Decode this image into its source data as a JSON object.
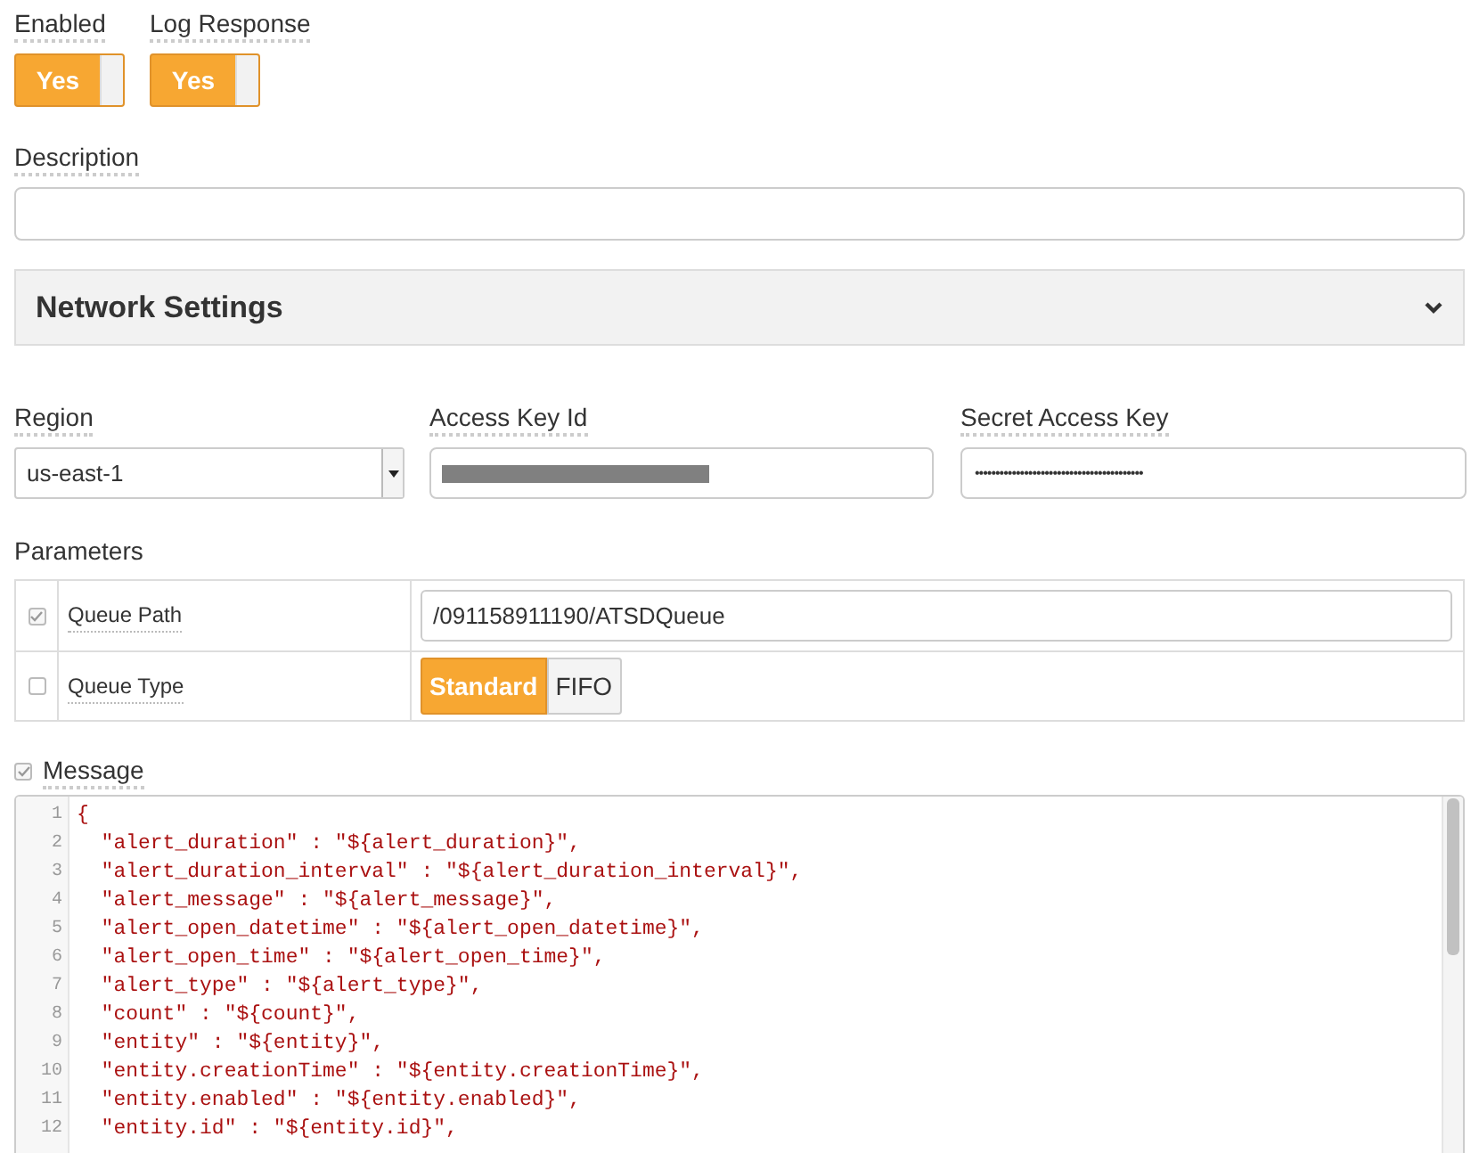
{
  "toggles": [
    {
      "label": "Enabled",
      "on": true,
      "text": "Yes"
    },
    {
      "label": "Log Response",
      "on": true,
      "text": "Yes"
    }
  ],
  "description": {
    "label": "Description"
  },
  "section": {
    "title": "Network Settings",
    "expanded": true
  },
  "region": {
    "label": "Region",
    "value": "us-east-1"
  },
  "access_key": {
    "label": "Access Key Id"
  },
  "secret_key": {
    "label": "Secret Access Key",
    "value": "•••••••••••••••••••••••••••••••••••••••••"
  },
  "parameters": {
    "label": "Parameters",
    "rows": [
      {
        "kind": "text",
        "name": "Queue Path",
        "checked": true,
        "value": "/091158911190/ATSDQueue"
      },
      {
        "kind": "choice",
        "name": "Queue Type",
        "checked": false,
        "options": [
          {
            "label": "Standard",
            "selected": true
          },
          {
            "label": "FIFO",
            "selected": false
          }
        ]
      }
    ]
  },
  "message": {
    "label": "Message",
    "checked": true,
    "lines": [
      {
        "number": "1",
        "text": "{"
      },
      {
        "number": "2",
        "text": "  \"alert_duration\" : \"${alert_duration}\","
      },
      {
        "number": "3",
        "text": "  \"alert_duration_interval\" : \"${alert_duration_interval}\","
      },
      {
        "number": "4",
        "text": "  \"alert_message\" : \"${alert_message}\","
      },
      {
        "number": "5",
        "text": "  \"alert_open_datetime\" : \"${alert_open_datetime}\","
      },
      {
        "number": "6",
        "text": "  \"alert_open_time\" : \"${alert_open_time}\","
      },
      {
        "number": "7",
        "text": "  \"alert_type\" : \"${alert_type}\","
      },
      {
        "number": "8",
        "text": "  \"count\" : \"${count}\","
      },
      {
        "number": "9",
        "text": "  \"entity\" : \"${entity}\","
      },
      {
        "number": "10",
        "text": "  \"entity.creationTime\" : \"${entity.creationTime}\","
      },
      {
        "number": "11",
        "text": "  \"entity.enabled\" : \"${entity.enabled}\","
      },
      {
        "number": "12",
        "text": "  \"entity.id\" : \"${entity.id}\","
      }
    ]
  }
}
